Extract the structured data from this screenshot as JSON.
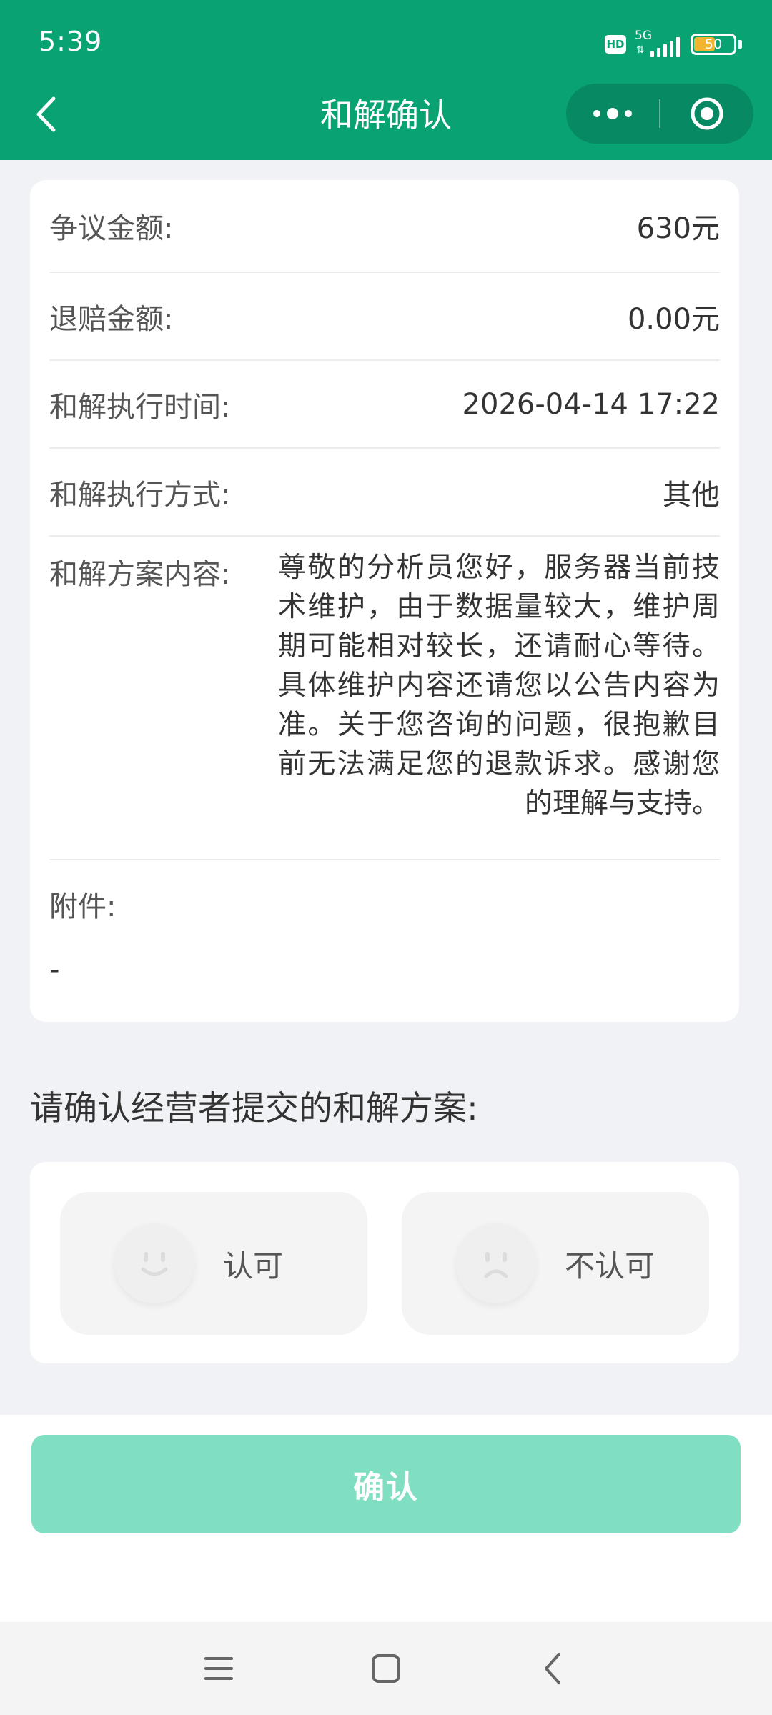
{
  "status_bar": {
    "time": "5:39",
    "hd": "HD",
    "network": "5G",
    "battery": "50",
    "battery_level": 0.5
  },
  "header": {
    "title": "和解确认"
  },
  "details": {
    "dispute_amount": {
      "label": "争议金额:",
      "value": "630元"
    },
    "refund_amount": {
      "label": "退赔金额:",
      "value": "0.00元"
    },
    "execution_time": {
      "label": "和解执行时间:",
      "value": "2026-04-14 17:22"
    },
    "execution_method": {
      "label": "和解执行方式:",
      "value": "其他"
    },
    "plan_content": {
      "label": "和解方案内容:",
      "value": "尊敬的分析员您好，服务器当前技术维护，由于数据量较大，维护周期可能相对较长，还请耐心等待。具体维护内容还请您以公告内容为准。关于您咨询的问题，很抱歉目前无法满足您的退款诉求。感谢您的理解与支持。"
    },
    "attachment": {
      "label": "附件:",
      "value": "-"
    }
  },
  "prompt": "请确认经营者提交的和解方案:",
  "choices": {
    "approve": {
      "label": "认可",
      "icon": "smile-face-icon"
    },
    "reject": {
      "label": "不认可",
      "icon": "sad-face-icon"
    }
  },
  "confirm_button": "确认",
  "colors": {
    "brand": "#08a273",
    "confirm_disabled": "#80dfc3"
  }
}
